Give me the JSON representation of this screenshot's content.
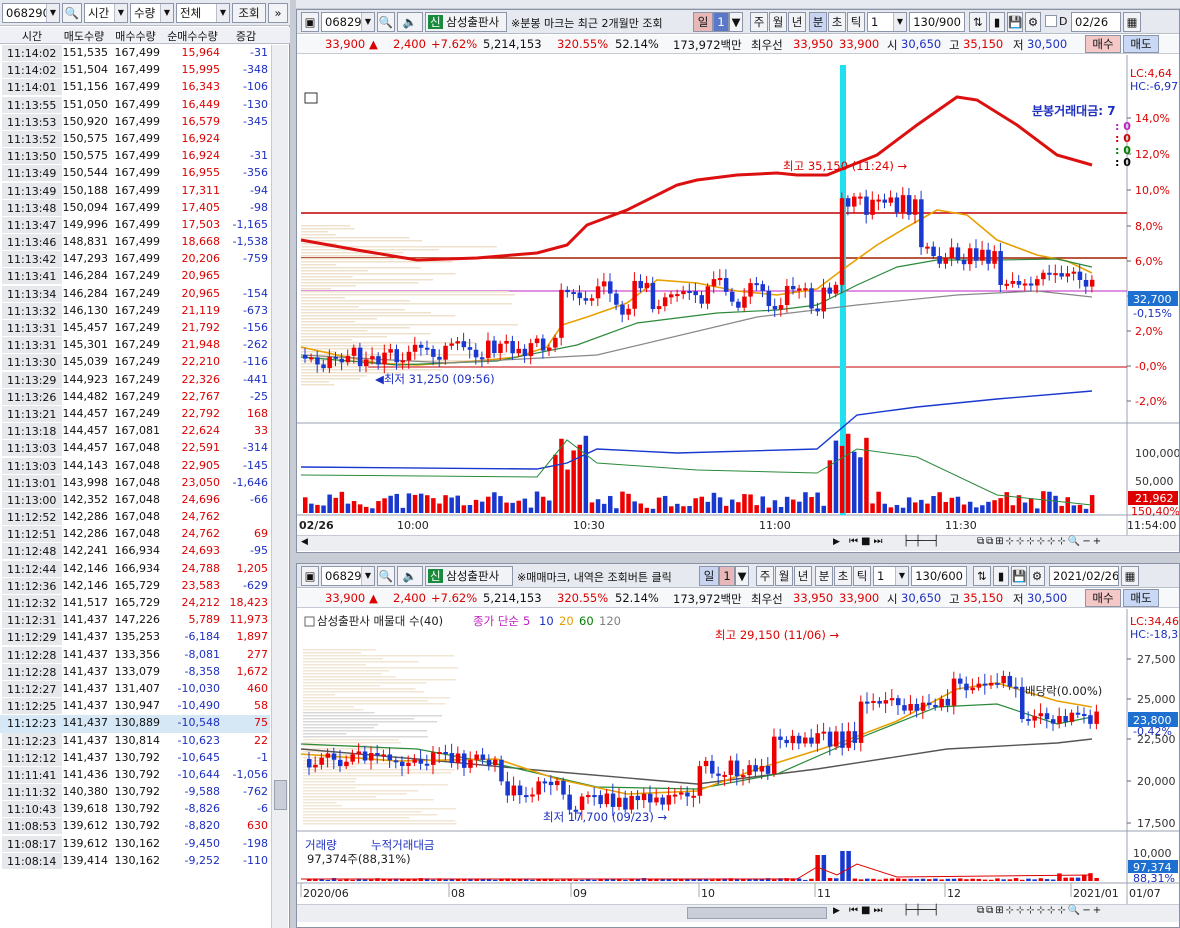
{
  "left_panel": {
    "stock_code": "068290",
    "mode": "시간",
    "field": "수량",
    "filter": "전체",
    "query_button": "조회",
    "columns": [
      "시간",
      "매도수량",
      "매수수량",
      "순매수수량",
      "증감"
    ],
    "rows": [
      [
        "11:14:02",
        "151,535",
        "167,499",
        "15,964",
        "-31"
      ],
      [
        "11:14:02",
        "151,504",
        "167,499",
        "15,995",
        "-348"
      ],
      [
        "11:14:01",
        "151,156",
        "167,499",
        "16,343",
        "-106"
      ],
      [
        "11:13:55",
        "151,050",
        "167,499",
        "16,449",
        "-130"
      ],
      [
        "11:13:53",
        "150,920",
        "167,499",
        "16,579",
        "-345"
      ],
      [
        "11:13:52",
        "150,575",
        "167,499",
        "16,924",
        ""
      ],
      [
        "11:13:50",
        "150,575",
        "167,499",
        "16,924",
        "-31"
      ],
      [
        "11:13:49",
        "150,544",
        "167,499",
        "16,955",
        "-356"
      ],
      [
        "11:13:49",
        "150,188",
        "167,499",
        "17,311",
        "-94"
      ],
      [
        "11:13:48",
        "150,094",
        "167,499",
        "17,405",
        "-98"
      ],
      [
        "11:13:47",
        "149,996",
        "167,499",
        "17,503",
        "-1,165"
      ],
      [
        "11:13:46",
        "148,831",
        "167,499",
        "18,668",
        "-1,538"
      ],
      [
        "11:13:42",
        "147,293",
        "167,499",
        "20,206",
        "-759"
      ],
      [
        "11:13:41",
        "146,284",
        "167,249",
        "20,965",
        ""
      ],
      [
        "11:13:34",
        "146,284",
        "167,249",
        "20,965",
        "-154"
      ],
      [
        "11:13:32",
        "146,130",
        "167,249",
        "21,119",
        "-673"
      ],
      [
        "11:13:31",
        "145,457",
        "167,249",
        "21,792",
        "-156"
      ],
      [
        "11:13:31",
        "145,301",
        "167,249",
        "21,948",
        "-262"
      ],
      [
        "11:13:30",
        "145,039",
        "167,249",
        "22,210",
        "-116"
      ],
      [
        "11:13:29",
        "144,923",
        "167,249",
        "22,326",
        "-441"
      ],
      [
        "11:13:26",
        "144,482",
        "167,249",
        "22,767",
        "-25"
      ],
      [
        "11:13:21",
        "144,457",
        "167,249",
        "22,792",
        "168"
      ],
      [
        "11:13:18",
        "144,457",
        "167,081",
        "22,624",
        "33"
      ],
      [
        "11:13:03",
        "144,457",
        "167,048",
        "22,591",
        "-314"
      ],
      [
        "11:13:03",
        "144,143",
        "167,048",
        "22,905",
        "-145"
      ],
      [
        "11:13:01",
        "143,998",
        "167,048",
        "23,050",
        "-1,646"
      ],
      [
        "11:13:00",
        "142,352",
        "167,048",
        "24,696",
        "-66"
      ],
      [
        "11:12:52",
        "142,286",
        "167,048",
        "24,762",
        ""
      ],
      [
        "11:12:51",
        "142,286",
        "167,048",
        "24,762",
        "69"
      ],
      [
        "11:12:48",
        "142,241",
        "166,934",
        "24,693",
        "-95"
      ],
      [
        "11:12:44",
        "142,146",
        "166,934",
        "24,788",
        "1,205"
      ],
      [
        "11:12:36",
        "142,146",
        "165,729",
        "23,583",
        "-629"
      ],
      [
        "11:12:32",
        "141,517",
        "165,729",
        "24,212",
        "18,423"
      ],
      [
        "11:12:31",
        "141,437",
        "147,226",
        "5,789",
        "11,973"
      ],
      [
        "11:12:29",
        "141,437",
        "135,253",
        "-6,184",
        "1,897"
      ],
      [
        "11:12:28",
        "141,437",
        "133,356",
        "-8,081",
        "277"
      ],
      [
        "11:12:28",
        "141,437",
        "133,079",
        "-8,358",
        "1,672"
      ],
      [
        "11:12:27",
        "141,437",
        "131,407",
        "-10,030",
        "460"
      ],
      [
        "11:12:25",
        "141,437",
        "130,947",
        "-10,490",
        "58"
      ],
      [
        "11:12:23",
        "141,437",
        "130,889",
        "-10,548",
        "75"
      ],
      [
        "11:12:23",
        "141,437",
        "130,814",
        "-10,623",
        "22"
      ],
      [
        "11:12:12",
        "141,437",
        "130,792",
        "-10,645",
        "-1"
      ],
      [
        "11:11:41",
        "141,436",
        "130,792",
        "-10,644",
        "-1,056"
      ],
      [
        "11:11:32",
        "140,380",
        "130,792",
        "-9,588",
        "-762"
      ],
      [
        "11:10:43",
        "139,618",
        "130,792",
        "-8,826",
        "-6"
      ],
      [
        "11:08:53",
        "139,612",
        "130,792",
        "-8,820",
        "630"
      ],
      [
        "11:08:17",
        "139,612",
        "130,162",
        "-9,450",
        "-198"
      ],
      [
        "11:08:14",
        "139,414",
        "130,162",
        "-9,252",
        "-110"
      ]
    ],
    "selected_row": 39
  },
  "top_chart": {
    "code": "068290",
    "name": "삼성출판사",
    "note": "※분봉 마크는 최근 2개월만 조회",
    "tf_buttons": [
      "일",
      "1",
      "주",
      "월",
      "년",
      "분",
      "초",
      "틱"
    ],
    "period": "1",
    "count": "130/900",
    "date": "02/26",
    "checkbox_label": "D",
    "price": "33,900",
    "change": "2,400",
    "pct": "+7.62%",
    "volume": "5,214,153",
    "vol_ratio": "320.55%",
    "turnover": "52.14%",
    "amount": "173,972백만",
    "bid_label": "최우선",
    "bid1": "33,950",
    "bid2": "33,900",
    "open_label": "시",
    "open": "30,650",
    "high_label": "고",
    "high": "35,150",
    "low_label": "저",
    "low": "30,500",
    "buy": "매수",
    "sell": "매도",
    "lc": "LC:4,64",
    "hc": "HC:-6,97",
    "legend_title": "분봉거래대금: 7",
    "legend_vals": [
      "0",
      "0",
      "0",
      "0"
    ],
    "legend_colors": [
      "#c020c0",
      "#d00000",
      "#008000",
      "#000000"
    ],
    "high_mark": "최고 35,150 (11:24) →",
    "low_mark": "◀최저 31,250 (09:56)",
    "price_tag": "32,700",
    "y_ticks": [
      "14,0%",
      "12,0%",
      "10,0%",
      "8,0%",
      "6,0%",
      "4,0%",
      "2,0%",
      "-0,0%",
      "-2,0%"
    ],
    "y_tag_pct": "-0,15%",
    "vol_ticks": [
      "100,000",
      "50,000"
    ],
    "vol_tag": "21,962",
    "vol_tag2": "150,40%",
    "x_ticks": [
      "02/26",
      "10:00",
      "10:30",
      "11:00",
      "11:30",
      "11:54:00"
    ]
  },
  "bottom_chart": {
    "code": "068290",
    "name": "삼성출판사",
    "note": "※매매마크, 내역은 조회버튼 클릭",
    "tf_buttons": [
      "일",
      "1",
      "주",
      "월",
      "년",
      "분",
      "초",
      "틱"
    ],
    "period": "1",
    "count": "130/600",
    "date": "2021/02/26",
    "price": "33,900",
    "change": "2,400",
    "pct": "+7.62%",
    "volume": "5,214,153",
    "vol_ratio": "320.55%",
    "turnover": "52.14%",
    "amount": "173,972백만",
    "bid_label": "최우선",
    "bid1": "33,950",
    "bid2": "33,900",
    "open_label": "시",
    "open": "30,650",
    "high_label": "고",
    "high": "35,150",
    "low_label": "저",
    "low": "30,500",
    "buy": "매수",
    "sell": "매도",
    "legend_name": "삼성출판사 매물대 수(40)",
    "ma_label": "종가 단순",
    "ma_vals": [
      "5",
      "10",
      "20",
      "60",
      "120"
    ],
    "ma_colors": [
      "#c020c0",
      "#1d2fc0",
      "#e0a000",
      "#008000",
      "#808080"
    ],
    "lc": "LC:34,46",
    "hc": "HC:-18,3",
    "high_mark": "최고 29,150 (11/06) →",
    "low_mark": "최저 17,700 (09/23) →",
    "div_mark": "배당락(0.00%)",
    "price_tag": "23,800",
    "y_tag_pct": "-0,42%",
    "y_ticks": [
      "27,500",
      "25,000",
      "22,500",
      "20,000",
      "17,500"
    ],
    "vol_legend1": "거래량",
    "vol_legend2": "누적거래대금",
    "vol_text": "97,374주(88,31%)",
    "vol_ticks": [
      "10,000"
    ],
    "vol_tag": "97,374",
    "vol_tag2": "88,31%",
    "x_ticks": [
      "2020/06",
      "08",
      "09",
      "10",
      "11",
      "12",
      "2021/01",
      "01/07"
    ]
  }
}
